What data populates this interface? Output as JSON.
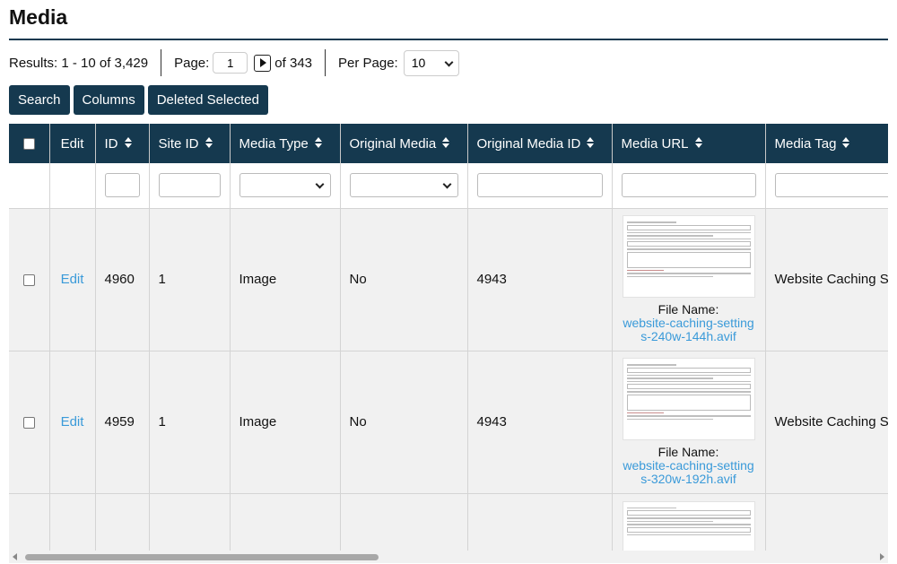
{
  "page": {
    "title": "Media"
  },
  "toolbar": {
    "results_text": "Results: 1 - 10 of 3,429",
    "page_label": "Page:",
    "page_value": "1",
    "page_total": "of 343",
    "per_page_label": "Per Page:",
    "per_page_value": "10"
  },
  "buttons": {
    "search": "Search",
    "columns": "Columns",
    "delete_selected": "Deleted Selected"
  },
  "table": {
    "headers": [
      "Edit",
      "ID",
      "Site ID",
      "Media Type",
      "Original Media",
      "Original Media ID",
      "Media URL",
      "Media Tag"
    ],
    "rows": [
      {
        "edit": "Edit",
        "id": "4960",
        "site_id": "1",
        "media_type": "Image",
        "original_media": "No",
        "original_media_id": "4943",
        "file_label": "File Name:",
        "file_name": "website-caching-settings-240w-144h.avif",
        "media_tag": "Website Caching Settings"
      },
      {
        "edit": "Edit",
        "id": "4959",
        "site_id": "1",
        "media_type": "Image",
        "original_media": "No",
        "original_media_id": "4943",
        "file_label": "File Name:",
        "file_name": "website-caching-settings-320w-192h.avif",
        "media_tag": "Website Caching Settings"
      }
    ]
  },
  "colors": {
    "header_bg": "#15394f",
    "link": "#3a9ad9",
    "row_bg": "#f1f1f1"
  }
}
